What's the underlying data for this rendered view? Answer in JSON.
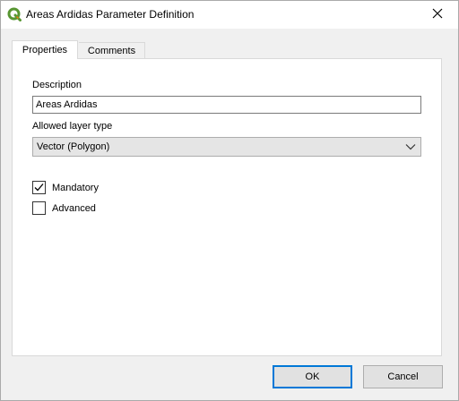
{
  "window": {
    "title": "Areas Ardidas Parameter Definition",
    "app_icon": "qgis-logo-icon",
    "close_icon": "close-icon"
  },
  "tabs": [
    {
      "label": "Properties",
      "active": true
    },
    {
      "label": "Comments",
      "active": false
    }
  ],
  "form": {
    "description_label": "Description",
    "description_value": "Areas Ardidas",
    "layer_type_label": "Allowed layer type",
    "layer_type_value": "Vector (Polygon)",
    "mandatory_label": "Mandatory",
    "mandatory_checked": true,
    "advanced_label": "Advanced",
    "advanced_checked": false
  },
  "buttons": {
    "ok_label": "OK",
    "cancel_label": "Cancel"
  },
  "colors": {
    "accent": "#0078d7",
    "qgis_green": "#589632",
    "qgis_yellow": "#ee7913"
  }
}
